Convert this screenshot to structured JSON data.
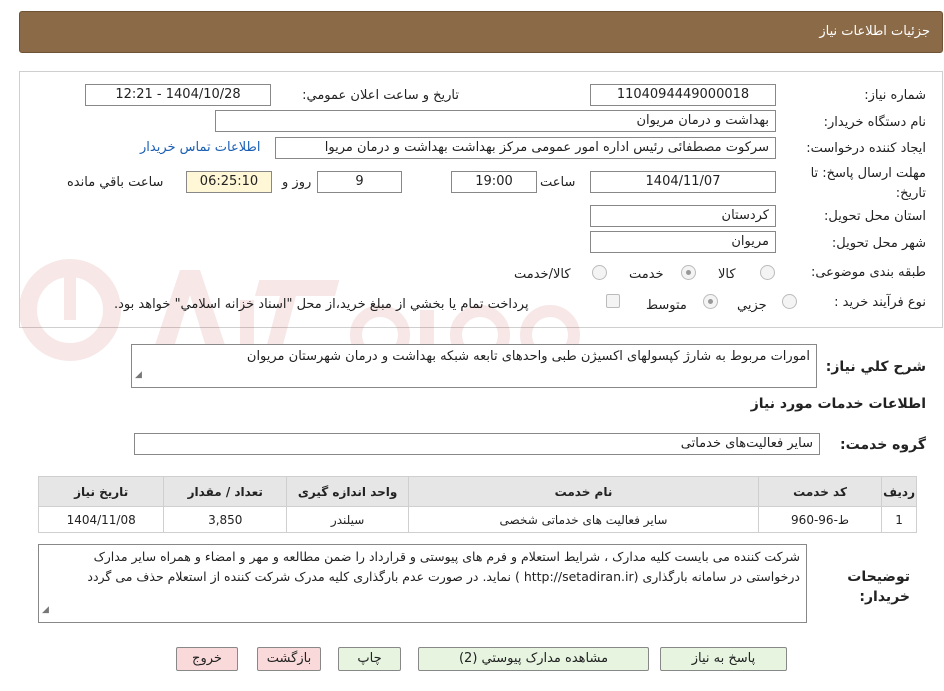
{
  "header": {
    "title": "جزئیات اطلاعات نیاز"
  },
  "form": {
    "need_number_label": "شماره نیاز:",
    "need_number": "1104094449000018",
    "announce_label": "تاریخ و ساعت اعلان عمومي:",
    "announce_value": "1404/10/28 - 12:21",
    "buyer_org_label": "نام دستگاه خريدار:",
    "buyer_org": "بهداشت و درمان مریوان",
    "requester_label": "ايجاد كننده درخواست:",
    "requester": "سرکوت مصطفائی رئیس اداره امور عمومی مرکز بهداشت بهداشت و درمان مریوا",
    "contact_link": "اطلاعات تماس خريدار",
    "deadline_label": "مهلت ارسال پاسخ: تا تاريخ:",
    "deadline_date": "1404/11/07",
    "time_label": "ساعت",
    "deadline_time": "19:00",
    "days_value": "9",
    "days_label": "روز و",
    "remaining_time": "06:25:10",
    "remaining_label": "ساعت باقي مانده",
    "province_label": "استان محل تحويل:",
    "province": "کردستان",
    "city_label": "شهر محل تحويل:",
    "city": "مریوان",
    "category_label": "طبقه بندی موضوعی:",
    "category_options": [
      "كالا",
      "خدمت",
      "كالا/خدمت"
    ],
    "category_selected": "خدمت",
    "process_label": "نوع فرآيند خريد :",
    "process_options": [
      "جزيي",
      "متوسط"
    ],
    "process_selected": "متوسط",
    "payment_note": "پرداخت تمام يا بخشي از مبلغ خريد،از محل \"اسناد خزانه اسلامي\" خواهد بود."
  },
  "summary": {
    "label": "شرح كلي نياز:",
    "text": "امورات مربوط به شارژ کپسولهای اکسیژن طبی واحدهای تابعه شبکه بهداشت و درمان شهرستان مریوان"
  },
  "services": {
    "section_title": "اطلاعات خدمات مورد نياز",
    "group_label": "گروه خدمت:",
    "group_value": "سایر فعالیت‌های خدماتی",
    "columns": [
      "رديف",
      "كد خدمت",
      "نام خدمت",
      "واحد اندازه گيری",
      "تعداد / مقدار",
      "تاريخ نياز"
    ],
    "rows": [
      [
        "1",
        "ط-96-960",
        "سایر فعالیت های خدماتی شخصی",
        "سیلندر",
        "3,850",
        "1404/11/08"
      ]
    ]
  },
  "buyer_notes": {
    "label": "توضيحات خريدار:",
    "text": "شرکت کننده می بایست  کلیه مدارک ، شرایط استعلام و فرم های پیوستی و قرارداد را ضمن مطالعه و مهر و امضاء و همراه سایر مدارک درخواستی در سامانه بارگذاری  (http://setadiran.ir )   نماید. در صورت عدم بارگذاری کلیه مدرک شرکت کننده از استعلام حذف می گردد"
  },
  "buttons": {
    "reply": "پاسخ به نياز",
    "attachments": "مشاهده مدارک پيوستي (2)",
    "print": "چاپ",
    "back": "بازگشت",
    "exit": "خروج"
  },
  "colors": {
    "header_bg": "#8b6a47",
    "green_btn": "#e6f4e0",
    "red_btn": "#f9d9d9"
  }
}
